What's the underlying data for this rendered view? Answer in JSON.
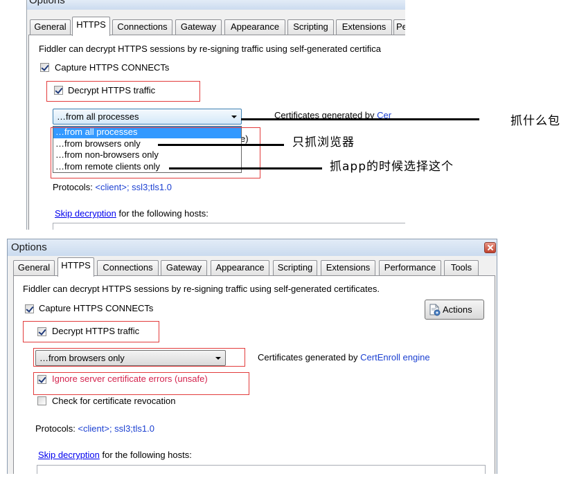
{
  "top_dialog": {
    "title": "Options",
    "tabs": [
      {
        "label": "General",
        "selected": false
      },
      {
        "label": "HTTPS",
        "selected": true
      },
      {
        "label": "Connections",
        "selected": false
      },
      {
        "label": "Gateway",
        "selected": false
      },
      {
        "label": "Appearance",
        "selected": false
      },
      {
        "label": "Scripting",
        "selected": false
      },
      {
        "label": "Extensions",
        "selected": false
      },
      {
        "label": "Pe",
        "selected": false
      }
    ],
    "intro": "Fiddler can decrypt HTTPS sessions by re-signing traffic using self-generated certifica",
    "capture": {
      "label": "Capture HTTPS CONNECTs",
      "checked": true
    },
    "decrypt": {
      "label": "Decrypt HTTPS traffic",
      "checked": true
    },
    "process_filter": {
      "value": "…from all processes",
      "open": true,
      "options": [
        {
          "label": "…from all processes",
          "highlighted": true
        },
        {
          "label": "…from browsers only",
          "highlighted": false
        },
        {
          "label": "…from non-browsers only",
          "highlighted": false
        },
        {
          "label": "…from remote clients only",
          "highlighted": false
        }
      ]
    },
    "certificates": {
      "prefix": "Certificates generated by ",
      "engine": "Cer"
    },
    "obscured_fragment": "e)",
    "protocols": {
      "label": "Protocols: ",
      "value": "<client>; ssl3;tls1.0"
    },
    "skip": {
      "link": "Skip decryption",
      "text": "for the following hosts:"
    }
  },
  "annotations": {
    "what_to_capture": "抓什么包",
    "browsers_only": "只抓浏览器",
    "app_capture": "抓app的时候选择这个"
  },
  "bottom_dialog": {
    "title": "Options",
    "close_icon": "close-icon",
    "tabs": [
      {
        "label": "General",
        "selected": false
      },
      {
        "label": "HTTPS",
        "selected": true
      },
      {
        "label": "Connections",
        "selected": false
      },
      {
        "label": "Gateway",
        "selected": false
      },
      {
        "label": "Appearance",
        "selected": false
      },
      {
        "label": "Scripting",
        "selected": false
      },
      {
        "label": "Extensions",
        "selected": false
      },
      {
        "label": "Performance",
        "selected": false
      },
      {
        "label": "Tools",
        "selected": false
      }
    ],
    "intro": "Fiddler can decrypt HTTPS sessions by re-signing traffic using self-generated certificates.",
    "capture": {
      "label": "Capture HTTPS CONNECTs",
      "checked": true
    },
    "actions": {
      "label": "Actions",
      "icon": "certificate-icon"
    },
    "decrypt": {
      "label": "Decrypt HTTPS traffic",
      "checked": true
    },
    "process_filter": {
      "value": "…from browsers only"
    },
    "certificates": {
      "prefix": "Certificates generated by ",
      "engine": "CertEnroll engine"
    },
    "ignore_errors": {
      "label": "Ignore server certificate errors (unsafe)",
      "checked": true
    },
    "check_revocation": {
      "label": "Check for certificate revocation",
      "checked": false
    },
    "protocols": {
      "label": "Protocols: ",
      "value": "<client>; ssl3;tls1.0"
    },
    "skip": {
      "link": "Skip decryption",
      "text": "for the following hosts:"
    }
  },
  "colors": {
    "annotation_box": "#e23b3b",
    "annotation_line": "#000000",
    "link": "#0000ee",
    "selection": "#3399ff",
    "warning_text": "#d4234d"
  }
}
